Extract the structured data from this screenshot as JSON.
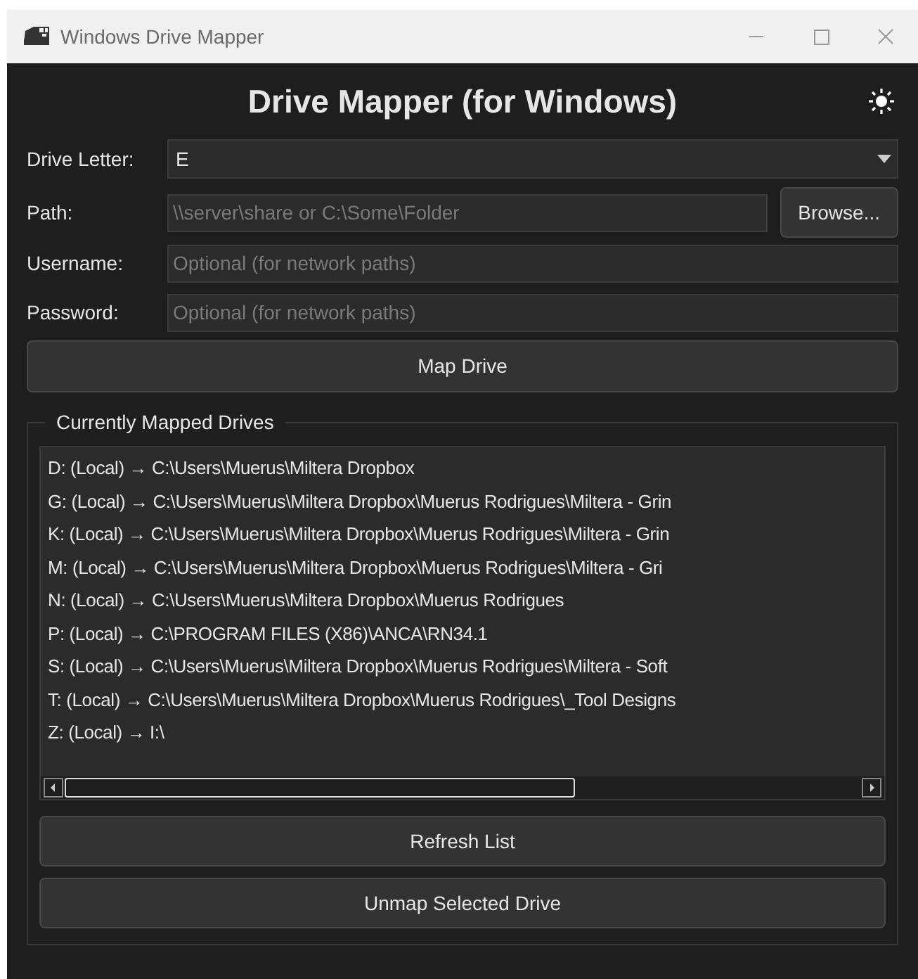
{
  "window": {
    "title": "Windows Drive Mapper"
  },
  "heading": "Drive Mapper (for Windows)",
  "form": {
    "drive_letter": {
      "label": "Drive Letter:",
      "value": "E"
    },
    "path": {
      "label": "Path:",
      "placeholder": "\\\\server\\share or C:\\Some\\Folder",
      "button": "Browse..."
    },
    "username": {
      "label": "Username:",
      "placeholder": "Optional (for network paths)"
    },
    "password": {
      "label": "Password:",
      "placeholder": "Optional (for network paths)"
    },
    "map_button": "Map Drive"
  },
  "mapped_drives": {
    "title": "Currently Mapped Drives",
    "items": [
      "D: (Local) → C:\\Users\\Muerus\\Miltera Dropbox",
      "G: (Local) → C:\\Users\\Muerus\\Miltera Dropbox\\Muerus Rodrigues\\Miltera - Grin",
      "K: (Local) → C:\\Users\\Muerus\\Miltera Dropbox\\Muerus Rodrigues\\Miltera - Grin",
      "M: (Local) → C:\\Users\\Muerus\\Miltera Dropbox\\Muerus Rodrigues\\Miltera - Gri",
      "N: (Local) → C:\\Users\\Muerus\\Miltera Dropbox\\Muerus Rodrigues",
      "P: (Local) → C:\\PROGRAM FILES (X86)\\ANCA\\RN34.1",
      "S: (Local) → C:\\Users\\Muerus\\Miltera Dropbox\\Muerus Rodrigues\\Miltera - Soft",
      "T: (Local) → C:\\Users\\Muerus\\Miltera Dropbox\\Muerus Rodrigues\\_Tool Designs",
      "Z: (Local) → I:\\"
    ],
    "buttons": [
      "Refresh List",
      "Unmap Selected Drive"
    ]
  }
}
